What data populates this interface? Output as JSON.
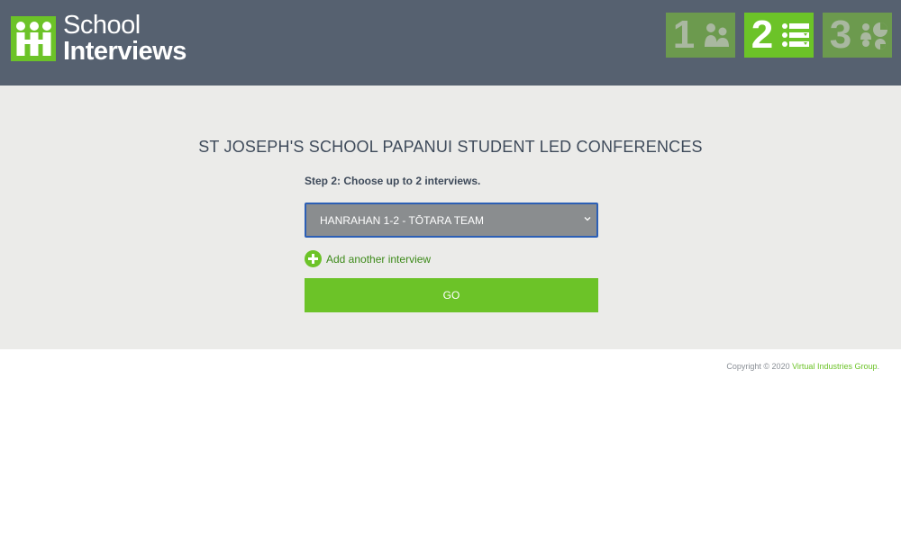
{
  "header": {
    "logo": {
      "line1": "School",
      "line2": "Interviews"
    },
    "steps": [
      {
        "number": "1",
        "icon": "people-icon",
        "state": "inactive"
      },
      {
        "number": "2",
        "icon": "list-icon",
        "state": "active"
      },
      {
        "number": "3",
        "icon": "schedule-icon",
        "state": "inactive"
      }
    ]
  },
  "main": {
    "title": "ST JOSEPH'S SCHOOL PAPANUI STUDENT LED CONFERENCES",
    "step_label": "Step 2: Choose up to 2 interviews.",
    "interview_select": {
      "selected": "HANRAHAN 1-2 - TŌTARA TEAM"
    },
    "add_another_label": "Add another interview",
    "go_label": "GO"
  },
  "footer": {
    "copyright": "Copyright © 2020",
    "company_link": "Virtual Industries Group",
    "suffix": "."
  },
  "colors": {
    "header_bg": "#566170",
    "accent_green": "#6cc328",
    "muted_green": "#6c9a4e",
    "select_bg": "#8a8d8f",
    "select_border": "#2c5fb5"
  }
}
